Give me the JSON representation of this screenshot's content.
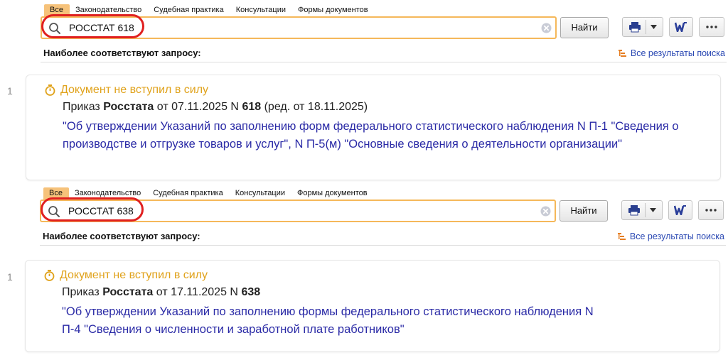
{
  "panels": [
    {
      "tabs": [
        "Все",
        "Законодательство",
        "Судебная практика",
        "Консультации",
        "Формы документов"
      ],
      "active_tab": 0,
      "search": {
        "value": "РОССТАТ 618",
        "button": "Найти"
      },
      "subheader": {
        "title": "Наиболее соответствуют запросу:",
        "all_results": "Все результаты поиска"
      },
      "result": {
        "index": "1",
        "status": "Документ не вступил в силу",
        "doc_type": "Приказ",
        "issuer": "Росстата",
        "date_text": "от 07.11.2025 N",
        "number": "618",
        "edition": "(ред. от 18.11.2025)",
        "title": "\"Об утверждении Указаний по заполнению форм федерального статистического наблюдения N П-1 \"Сведения о производстве и отгрузке товаров и услуг\", N П-5(м) \"Основные сведения о деятельности организации\""
      }
    },
    {
      "tabs": [
        "Все",
        "Законодательство",
        "Судебная практика",
        "Консультации",
        "Формы документов"
      ],
      "active_tab": 0,
      "search": {
        "value": "РОССТАТ 638",
        "button": "Найти"
      },
      "subheader": {
        "title": "Наиболее соответствуют запросу:",
        "all_results": "Все результаты поиска"
      },
      "result": {
        "index": "1",
        "status": "Документ не вступил в силу",
        "doc_type": "Приказ",
        "issuer": "Росстата",
        "date_text": "от 17.11.2025 N",
        "number": "638",
        "edition": "",
        "title": "\"Об утверждении Указаний по заполнению формы федерального статистического наблюдения N П-4 \"Сведения о численности и заработной плате работников\""
      }
    }
  ],
  "icons": {
    "search": "magnifier-icon",
    "clear": "clear-circle-icon",
    "print": "printer-icon",
    "dropdown": "chevron-down-icon",
    "word": "word-export-icon",
    "more": "ellipsis-icon",
    "status": "stopwatch-icon",
    "results": "results-list-icon"
  },
  "colors": {
    "accent_tab": "#f6c27a",
    "search_border": "#f5b85a",
    "highlight_ring": "#e02020",
    "status": "#e0a21b",
    "link": "#2a2aa6",
    "results_link": "#2a48b3"
  }
}
